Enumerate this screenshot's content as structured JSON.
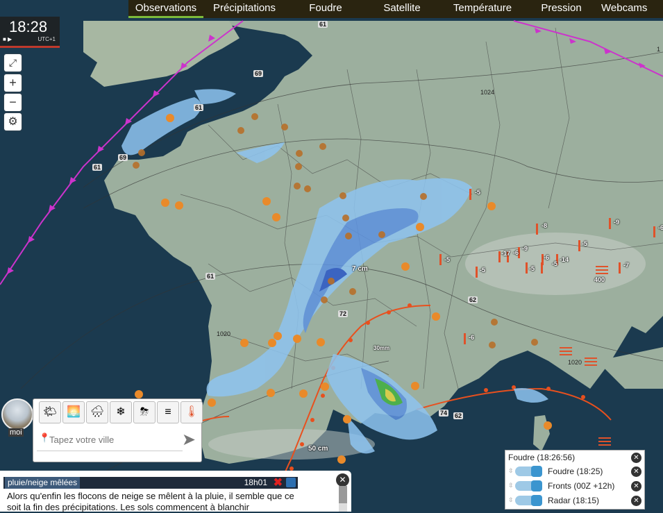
{
  "nav": {
    "tabs": [
      {
        "label": "Observations",
        "active": true
      },
      {
        "label": "Précipitations"
      },
      {
        "label": "Foudre"
      },
      {
        "label": "Satellite"
      },
      {
        "label": "Température"
      },
      {
        "label": "Pression"
      },
      {
        "label": "Webcams"
      }
    ]
  },
  "clock": {
    "time": "18:28",
    "timezone": "UTC+1"
  },
  "map_controls": {
    "fullscreen_icon": "expand-icon",
    "zoom_in": "+",
    "zoom_out": "−",
    "settings_icon": "gear-icon"
  },
  "map_labels": {
    "wind": [
      "61",
      "69",
      "61",
      "69",
      "61",
      "61",
      "62",
      "72",
      "74",
      "62"
    ],
    "temperature": [
      "-5",
      "-8",
      "-9",
      "-5",
      "-6",
      "-5",
      "-17",
      "-6",
      "-5",
      "-6",
      "-5",
      "-14",
      "-5",
      "-7",
      "-9",
      "-6"
    ],
    "snow": [
      "7 cm",
      "50 cm",
      "30mm",
      "400"
    ],
    "isobars": [
      "1024",
      "1020",
      "1020",
      "1"
    ]
  },
  "search": {
    "avatar_label": "moi",
    "placeholder": "Tapez votre ville",
    "filter_icons": [
      "sun-cloud-icon",
      "sunset-icon",
      "rain-cloud-icon",
      "snow-cloud-icon",
      "thunder-cloud-icon",
      "fog-icon",
      "thermometer-icon"
    ]
  },
  "news": {
    "tag": "pluie/neige mêlées",
    "time": "18h01",
    "text": "Alors qu'enfin les flocons de neige se mêlent à la pluie, il semble que ce soit la fin des précipitations. Les sols commencent à blanchir"
  },
  "layers": {
    "title": "Foudre (18:26:56)",
    "items": [
      {
        "label": "Foudre (18:25)"
      },
      {
        "label": "Fronts (00Z +12h)"
      },
      {
        "label": "Radar (18:15)"
      }
    ]
  },
  "colors": {
    "sea": "#1b3a4f",
    "land": "#9caf9e",
    "nav_bg": "#2a2410",
    "active_tab": "#7dbb3a",
    "cold_front": "#cc33cc",
    "warm_front": "#e8501e",
    "radar_light": "#8ec4f0",
    "radar_dark": "#2b58c8"
  }
}
